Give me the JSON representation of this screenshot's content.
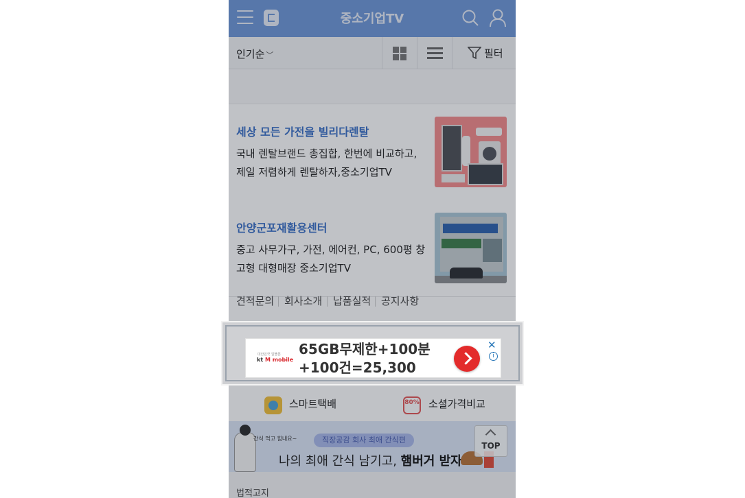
{
  "header": {
    "title": "중소기업TV"
  },
  "filterbar": {
    "sort_label": "인기순",
    "filter_label": "필터"
  },
  "articles": [
    {
      "title": "세상 모든 가전을 빌리다렌탈",
      "description": "국내 렌탈브랜드 총집합, 한번에 비교하고, 제일 저렴하게 렌탈하자,중소기업TV"
    },
    {
      "title": "안양군포재활용센터",
      "description": "중고 사무가구, 가전, 에어컨, PC, 600평 창고형 대형매장 중소기업TV"
    }
  ],
  "links": [
    "견적문의",
    "회사소개",
    "납품실적",
    "공지사항"
  ],
  "ad": {
    "brand_tiny": "대한민국 알뜰폰",
    "brand_kt": "kt",
    "brand_rest": "M mobile",
    "headline_line1": "65GB무제한+100분",
    "headline_line2": "+100건=25,300",
    "close": "✕",
    "info": "i"
  },
  "services": [
    {
      "label": "스마트택배",
      "icon": "delivery-icon"
    },
    {
      "label": "소셜가격비교",
      "icon": "compare-icon",
      "badge": "80%"
    }
  ],
  "banner": {
    "pill": "직장공감 회사 최애 간식편",
    "text_plain": "나의 최애 간식 남기고, ",
    "text_bold": "햄버거 받자!",
    "doodle": "간식 먹고 힘내요~"
  },
  "top_button": "TOP",
  "footer": {
    "label": "법적고지"
  },
  "colors": {
    "header_bg": "#6e97d8",
    "title_blue": "#3a6fc6",
    "ad_red": "#e32b2b"
  }
}
